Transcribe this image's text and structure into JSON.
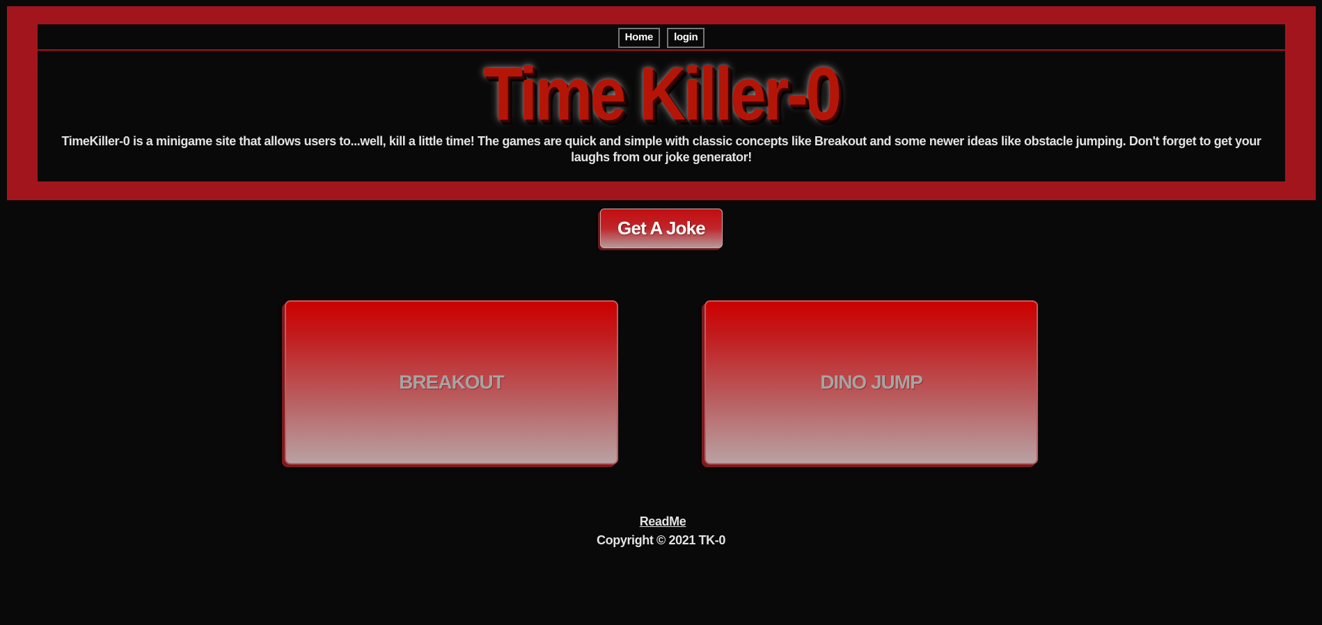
{
  "nav": {
    "items": [
      {
        "label": "Home"
      },
      {
        "label": "login"
      }
    ]
  },
  "header": {
    "title": "Time Killer-0",
    "description": "TimeKiller-0 is a minigame site that allows users to...well, kill a little time! The games are quick and simple with classic concepts like Breakout and some newer ideas like obstacle jumping. Don't forget to get your laughs from our joke generator!"
  },
  "joke_button": {
    "label": "Get A Joke"
  },
  "games": [
    {
      "label": "BREAKOUT"
    },
    {
      "label": "DINO JUMP"
    }
  ],
  "footer": {
    "readme_label": "ReadMe",
    "copyright": "Copyright © 2021 TK-0"
  },
  "colors": {
    "banner": "#a3151c",
    "background": "#0a0909",
    "accent": "#cc0000"
  }
}
